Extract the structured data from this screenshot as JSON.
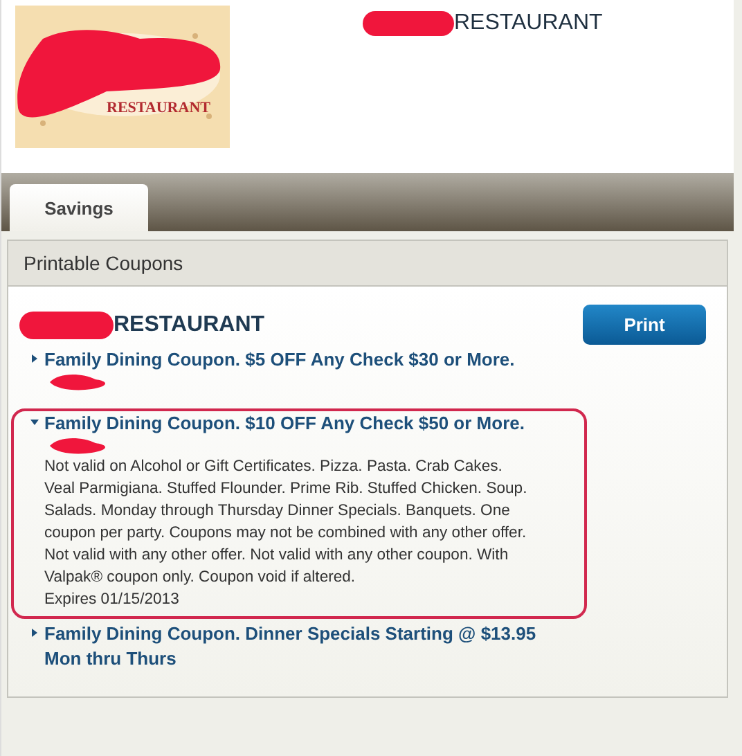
{
  "header": {
    "logo": {
      "kind": "picture",
      "text": "RESTAURANT",
      "redacted": true
    },
    "title": {
      "text": "RESTAURANT",
      "redacted": true
    }
  },
  "tabs": [
    {
      "label": "Savings",
      "selected": true
    }
  ],
  "panel": {
    "title": "Printable Coupons",
    "business": {
      "text": "RESTAURANT",
      "redacted": true
    },
    "print_button": "Print",
    "coupons": [
      {
        "title": "Family Dining Coupon. $5 OFF Any Check $30 or More.",
        "expanded": false,
        "redacted_line": true,
        "highlighted": false
      },
      {
        "title": "Family Dining Coupon. $10 OFF Any Check $50 or More.",
        "expanded": true,
        "redacted_line": true,
        "highlighted": true,
        "details": "Not valid on Alcohol or Gift Certificates. Pizza. Pasta. Crab Cakes. Veal Parmigiana. Stuffed Flounder. Prime Rib. Stuffed Chicken. Soup. Salads. Monday through Thursday Dinner Specials. Banquets. One coupon per party. Coupons may not be combined with any other offer. Not valid with any other offer. Not valid with any other coupon. With Valpak® coupon only. Coupon void if altered.",
        "expires": "Expires 01/15/2013"
      },
      {
        "title": "Family Dining Coupon. Dinner Specials Starting @ $13.95 Mon thru Thurs",
        "expanded": false,
        "redacted_line": false,
        "highlighted": false
      }
    ]
  }
}
